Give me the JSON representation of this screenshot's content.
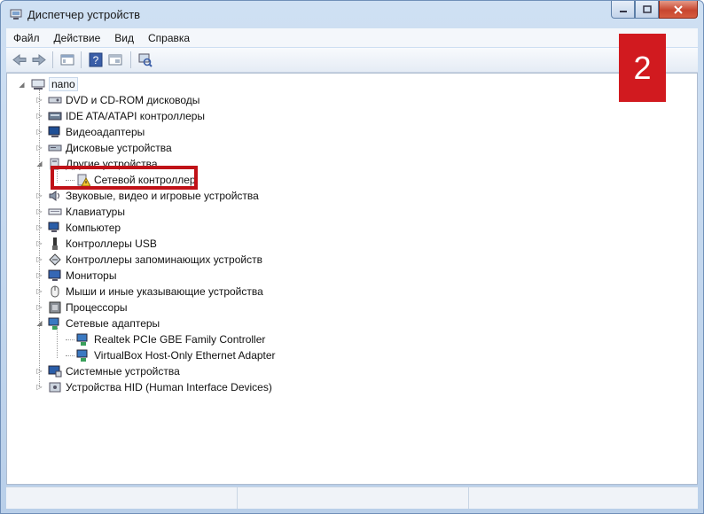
{
  "window": {
    "title": "Диспетчер устройств"
  },
  "menu": [
    "Файл",
    "Действие",
    "Вид",
    "Справка"
  ],
  "toolbar": {
    "icons": [
      "back-icon",
      "forward-icon",
      "properties-icon",
      "help-icon",
      "update-icon",
      "scan-hardware-icon"
    ]
  },
  "badge": "2",
  "tree": {
    "root": "nano",
    "items": [
      {
        "label": "DVD и CD-ROM дисководы",
        "icon": "dvd-drive-icon",
        "level": 1,
        "expander": "collapsed"
      },
      {
        "label": "IDE ATA/ATAPI контроллеры",
        "icon": "ide-controller-icon",
        "level": 1,
        "expander": "collapsed"
      },
      {
        "label": "Видеоадаптеры",
        "icon": "display-adapter-icon",
        "level": 1,
        "expander": "collapsed"
      },
      {
        "label": "Дисковые устройства",
        "icon": "disk-drive-icon",
        "level": 1,
        "expander": "collapsed"
      },
      {
        "label": "Другие устройства",
        "icon": "other-devices-icon",
        "level": 1,
        "expander": "expanded"
      },
      {
        "label": "Сетевой контроллер",
        "icon": "warning-device-icon",
        "level": 2,
        "expander": "none"
      },
      {
        "label": "Звуковые, видео и игровые устройства",
        "icon": "sound-icon",
        "level": 1,
        "expander": "collapsed"
      },
      {
        "label": "Клавиатуры",
        "icon": "keyboard-icon",
        "level": 1,
        "expander": "collapsed"
      },
      {
        "label": "Компьютер",
        "icon": "computer-icon",
        "level": 1,
        "expander": "collapsed"
      },
      {
        "label": "Контроллеры USB",
        "icon": "usb-icon",
        "level": 1,
        "expander": "collapsed"
      },
      {
        "label": "Контроллеры запоминающих устройств",
        "icon": "storage-controller-icon",
        "level": 1,
        "expander": "collapsed"
      },
      {
        "label": "Мониторы",
        "icon": "monitor-icon",
        "level": 1,
        "expander": "collapsed"
      },
      {
        "label": "Мыши и иные указывающие устройства",
        "icon": "mouse-icon",
        "level": 1,
        "expander": "collapsed"
      },
      {
        "label": "Процессоры",
        "icon": "processor-icon",
        "level": 1,
        "expander": "collapsed"
      },
      {
        "label": "Сетевые адаптеры",
        "icon": "network-adapter-icon",
        "level": 1,
        "expander": "expanded"
      },
      {
        "label": "Realtek PCIe GBE Family Controller",
        "icon": "network-card-icon",
        "level": 2,
        "expander": "none"
      },
      {
        "label": "VirtualBox Host-Only Ethernet Adapter",
        "icon": "network-card-icon",
        "level": 2,
        "expander": "none"
      },
      {
        "label": "Системные устройства",
        "icon": "system-devices-icon",
        "level": 1,
        "expander": "collapsed"
      },
      {
        "label": "Устройства HID (Human Interface Devices)",
        "icon": "hid-icon",
        "level": 1,
        "expander": "collapsed"
      }
    ]
  },
  "colors": {
    "accent": "#d11a1f",
    "highlight": "#c01218"
  }
}
